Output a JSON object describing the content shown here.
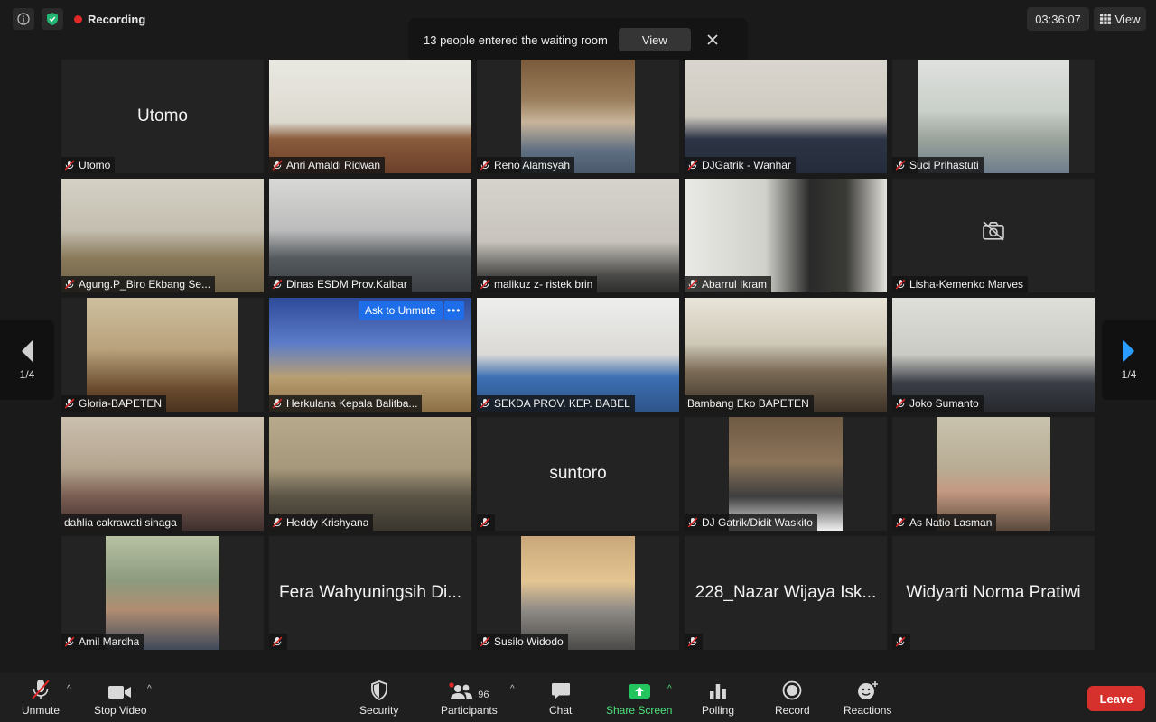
{
  "topbar": {
    "recording_label": "Recording",
    "timer": "03:36:07",
    "view_label": "View",
    "icons": [
      "info-icon",
      "shield-check-icon",
      "recording-dot-icon",
      "grid-view-icon"
    ],
    "shield_color": "#22b573",
    "recording_color": "#e02828"
  },
  "notification": {
    "text": "13 people entered the waiting room",
    "view_button": "View"
  },
  "pager": {
    "page_left": "1/4",
    "page_right": "1/4",
    "arrow_color": "#2b9cff"
  },
  "tiles": [
    {
      "name": "Utomo",
      "video": false,
      "big_name": "Utomo"
    },
    {
      "name": "Anri Amaldi Ridwan",
      "video": true
    },
    {
      "name": "Reno Alamsyah",
      "video": true
    },
    {
      "name": "DJGatrik - Wanhar",
      "video": true
    },
    {
      "name": "Suci Prihastuti",
      "video": true
    },
    {
      "name": "Agung.P_Biro Ekbang Se...",
      "video": true
    },
    {
      "name": "Dinas ESDM Prov.Kalbar",
      "video": true
    },
    {
      "name": "malikuz z- ristek brin",
      "video": true
    },
    {
      "name": "Abarrul Ikram",
      "video": true
    },
    {
      "name": "Lisha-Kemenko Marves",
      "video": false,
      "camera_off_icon": true
    },
    {
      "name": "Gloria-BAPETEN",
      "video": true
    },
    {
      "name": "Herkulana Kepala Balitba...",
      "video": true,
      "popup": {
        "unmute": "Ask to Unmute",
        "more": "•••"
      }
    },
    {
      "name": "SEKDA PROV. KEP. BABEL",
      "video": true
    },
    {
      "name": "Bambang Eko BAPETEN",
      "video": true,
      "active_speaker": true,
      "muted": false
    },
    {
      "name": "Joko Sumanto",
      "video": true
    },
    {
      "name": "dahlia cakrawati sinaga",
      "video": true,
      "muted": false
    },
    {
      "name": "Heddy Krishyana",
      "video": true
    },
    {
      "name": "",
      "video": false,
      "big_name": "suntoro"
    },
    {
      "name": "DJ Gatrik/Didit Waskito",
      "video": true
    },
    {
      "name": "As Natio Lasman",
      "video": true
    },
    {
      "name": "Amil Mardha",
      "video": true
    },
    {
      "name": "",
      "video": false,
      "big_name": "Fera Wahyuningsih Di..."
    },
    {
      "name": "Susilo Widodo",
      "video": true
    },
    {
      "name": "",
      "video": false,
      "big_name": "228_Nazar Wijaya Isk..."
    },
    {
      "name": "",
      "video": false,
      "big_name": "Widyarti Norma Pratiwi"
    }
  ],
  "toolbar": {
    "unmute": "Unmute",
    "stop_video": "Stop Video",
    "security": "Security",
    "participants": "Participants",
    "participants_count": "96",
    "chat": "Chat",
    "share_screen": "Share Screen",
    "polling": "Polling",
    "record": "Record",
    "reactions": "Reactions",
    "leave": "Leave",
    "share_color": "#22c55e",
    "leave_color": "#d6312c"
  }
}
